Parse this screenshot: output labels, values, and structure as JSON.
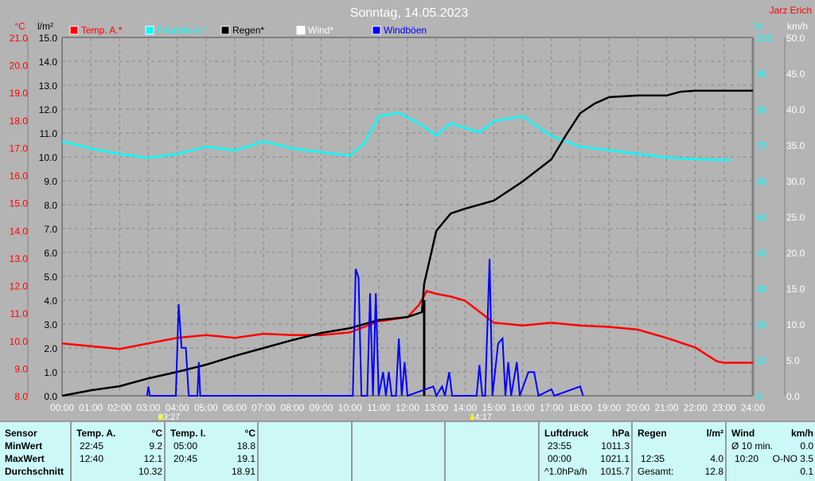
{
  "header": {
    "title": "Sonntag, 14.05.2023",
    "station": "Jarz Erich"
  },
  "chart_data": {
    "type": "line",
    "title": "Sonntag, 14.05.2023",
    "x_unit": "hours",
    "xlim": [
      0,
      24
    ],
    "x_ticks": [
      "00:00",
      "01:00",
      "02:00",
      "03:00",
      "04:00",
      "05:00",
      "06:00",
      "07:00",
      "08:00",
      "09:00",
      "10:00",
      "11:00",
      "12:00",
      "13:00",
      "14:00",
      "15:00",
      "16:00",
      "17:00",
      "18:00",
      "19:00",
      "20:00",
      "21:00",
      "22:00",
      "23:00",
      "24:00"
    ],
    "axes": {
      "temp": {
        "label": "°C",
        "range": [
          8,
          21
        ],
        "ticks": [
          "21.0",
          "20.0",
          "19.0",
          "18.0",
          "17.0",
          "16.0",
          "15.0",
          "14.0",
          "13.0",
          "12.0",
          "11.0",
          "10.0",
          "9.0",
          "8.0"
        ]
      },
      "rain": {
        "label": "l/m²",
        "range": [
          0,
          15
        ],
        "ticks": [
          "15.0",
          "14.0",
          "13.0",
          "12.0",
          "11.0",
          "10.0",
          "9.0",
          "8.0",
          "7.0",
          "6.0",
          "5.0",
          "4.0",
          "3.0",
          "2.0",
          "1.0",
          "0.0"
        ]
      },
      "humidity": {
        "label": "%",
        "range": [
          0,
          100
        ],
        "ticks": [
          "100",
          "90",
          "80",
          "70",
          "60",
          "50",
          "40",
          "30",
          "20",
          "10",
          "0"
        ]
      },
      "wind": {
        "label": "km/h",
        "range": [
          0,
          50
        ],
        "ticks": [
          "50.0",
          "45.0",
          "40.0",
          "35.0",
          "30.0",
          "25.0",
          "20.0",
          "15.0",
          "10.0",
          "5.0",
          "0.0"
        ]
      }
    },
    "legend": [
      "Temp. A.*",
      "Feuchte A.*",
      "Regen*",
      "Wind*",
      "Windböen"
    ],
    "markers": [
      {
        "time": 3.45,
        "label": "03:27"
      },
      {
        "time": 14.28,
        "label": "14:17"
      }
    ],
    "series": [
      {
        "name": "Temp. A.*",
        "axis": "temp",
        "color": "#ff0000",
        "points": [
          [
            0,
            9.9
          ],
          [
            1,
            9.8
          ],
          [
            2,
            9.7
          ],
          [
            3,
            9.9
          ],
          [
            4,
            10.1
          ],
          [
            5,
            10.2
          ],
          [
            6,
            10.1
          ],
          [
            7,
            10.25
          ],
          [
            8,
            10.2
          ],
          [
            9,
            10.2
          ],
          [
            10,
            10.3
          ],
          [
            11,
            10.7
          ],
          [
            12,
            10.85
          ],
          [
            12.4,
            11.3
          ],
          [
            12.67,
            11.8
          ],
          [
            13,
            11.7
          ],
          [
            13.5,
            11.6
          ],
          [
            14,
            11.45
          ],
          [
            15,
            10.65
          ],
          [
            16,
            10.55
          ],
          [
            17,
            10.65
          ],
          [
            18,
            10.55
          ],
          [
            19,
            10.5
          ],
          [
            20,
            10.4
          ],
          [
            21,
            10.1
          ],
          [
            22,
            9.75
          ],
          [
            22.75,
            9.25
          ],
          [
            23,
            9.2
          ],
          [
            24,
            9.2
          ]
        ]
      },
      {
        "name": "Feuchte A.*",
        "axis": "humidity",
        "color": "#00ffff",
        "points": [
          [
            0,
            71
          ],
          [
            1,
            69
          ],
          [
            2,
            67.5
          ],
          [
            3,
            66.4
          ],
          [
            4,
            67.5
          ],
          [
            5,
            69.5
          ],
          [
            6,
            68.5
          ],
          [
            7,
            71
          ],
          [
            8,
            69
          ],
          [
            9,
            68
          ],
          [
            10,
            67
          ],
          [
            10.5,
            70.5
          ],
          [
            11,
            78
          ],
          [
            11.7,
            79
          ],
          [
            12.5,
            75.5
          ],
          [
            13,
            72.7
          ],
          [
            13.5,
            76
          ],
          [
            14.5,
            73.5
          ],
          [
            15,
            76.7
          ],
          [
            16,
            78
          ],
          [
            17,
            72.5
          ],
          [
            18,
            69.5
          ],
          [
            19,
            68.5
          ],
          [
            20,
            67.5
          ],
          [
            21,
            66.5
          ],
          [
            22,
            66
          ],
          [
            23,
            65.8
          ],
          [
            23.25,
            65.8
          ]
        ]
      },
      {
        "name": "Regen*",
        "axis": "rain",
        "color": "#000000",
        "points": [
          [
            0,
            0
          ],
          [
            1,
            0.23
          ],
          [
            2,
            0.4
          ],
          [
            3,
            0.73
          ],
          [
            4,
            1.0
          ],
          [
            5,
            1.3
          ],
          [
            6,
            1.67
          ],
          [
            7,
            2.0
          ],
          [
            8,
            2.33
          ],
          [
            9,
            2.63
          ],
          [
            10,
            2.83
          ],
          [
            11,
            3.17
          ],
          [
            12,
            3.3
          ],
          [
            12.5,
            3.5
          ],
          [
            12.58,
            4.7
          ],
          [
            13,
            6.9
          ],
          [
            13.5,
            7.63
          ],
          [
            14,
            7.83
          ],
          [
            15,
            8.17
          ],
          [
            15.5,
            8.57
          ],
          [
            16,
            8.97
          ],
          [
            17,
            9.9
          ],
          [
            17.5,
            10.9
          ],
          [
            18,
            11.83
          ],
          [
            18.5,
            12.23
          ],
          [
            19,
            12.5
          ],
          [
            20,
            12.57
          ],
          [
            21,
            12.57
          ],
          [
            21.5,
            12.73
          ],
          [
            22,
            12.77
          ],
          [
            24,
            12.77
          ]
        ]
      },
      {
        "name": "Windböen",
        "axis": "wind",
        "color": "#0000ff",
        "points": [
          [
            2.95,
            0
          ],
          [
            3,
            1.3
          ],
          [
            3.05,
            0
          ],
          [
            3.95,
            0
          ],
          [
            4.05,
            12.8
          ],
          [
            4.15,
            6.7
          ],
          [
            4.3,
            6.7
          ],
          [
            4.4,
            0
          ],
          [
            4.7,
            0
          ],
          [
            4.75,
            4.7
          ],
          [
            4.8,
            0
          ],
          [
            10.1,
            0
          ],
          [
            10.2,
            17.7
          ],
          [
            10.3,
            16.5
          ],
          [
            10.4,
            0
          ],
          [
            10.6,
            0
          ],
          [
            10.7,
            14.3
          ],
          [
            10.8,
            0
          ],
          [
            10.9,
            14.3
          ],
          [
            11,
            0
          ],
          [
            11.15,
            3.3
          ],
          [
            11.25,
            0
          ],
          [
            11.35,
            3.3
          ],
          [
            11.45,
            0
          ],
          [
            11.6,
            0
          ],
          [
            11.7,
            8
          ],
          [
            11.8,
            0
          ],
          [
            11.9,
            4.7
          ],
          [
            12,
            0
          ],
          [
            12.9,
            1.3
          ],
          [
            13,
            0
          ],
          [
            13.2,
            1.3
          ],
          [
            13.3,
            0
          ],
          [
            13.45,
            3.3
          ],
          [
            13.55,
            0
          ],
          [
            14.4,
            0
          ],
          [
            14.5,
            4.3
          ],
          [
            14.6,
            0
          ],
          [
            14.7,
            0
          ],
          [
            14.85,
            19.1
          ],
          [
            14.95,
            0
          ],
          [
            15.15,
            7.3
          ],
          [
            15.3,
            8
          ],
          [
            15.4,
            0
          ],
          [
            15.5,
            4.7
          ],
          [
            15.6,
            0
          ],
          [
            15.8,
            4.7
          ],
          [
            15.9,
            0
          ],
          [
            16.2,
            3.3
          ],
          [
            16.4,
            3.3
          ],
          [
            16.55,
            0
          ],
          [
            17,
            0.9
          ],
          [
            17.1,
            0
          ],
          [
            18,
            1.3
          ],
          [
            18.1,
            0
          ]
        ]
      }
    ]
  },
  "table": {
    "rows": [
      "Sensor",
      "MinWert",
      "MaxWert",
      "Durchschnitt"
    ],
    "temp_a": {
      "title": "Temp. A.",
      "unit": "°C",
      "min_time": "22:45",
      "min": "9.2",
      "max_time": "12:40",
      "max": "12.1",
      "avg": "10.32"
    },
    "temp_i": {
      "title": "Temp. I.",
      "unit": "°C",
      "min_time": "05:00",
      "min": "18.8",
      "max_time": "20:45",
      "max": "19.1",
      "avg": "18.91"
    },
    "pressure": {
      "title": "Luftdruck",
      "unit": "hPa",
      "min_time": "23:55",
      "min": "1011.3",
      "max_time": "00:00",
      "max": "1021.1",
      "trend": "^1.0hPa/h",
      "avg": "1015.7"
    },
    "rain": {
      "title": "Regen",
      "unit": "l/m²",
      "max_time": "12:35",
      "max": "4.0",
      "total_label": "Gesamt:",
      "total": "12.8"
    },
    "wind": {
      "title": "Wind",
      "unit": "km/h",
      "avg_label": "Ø 10 min.",
      "avg": "0.0",
      "max_time": "10:20",
      "max": "O-NO 3.5",
      "mean": "0.1"
    }
  }
}
